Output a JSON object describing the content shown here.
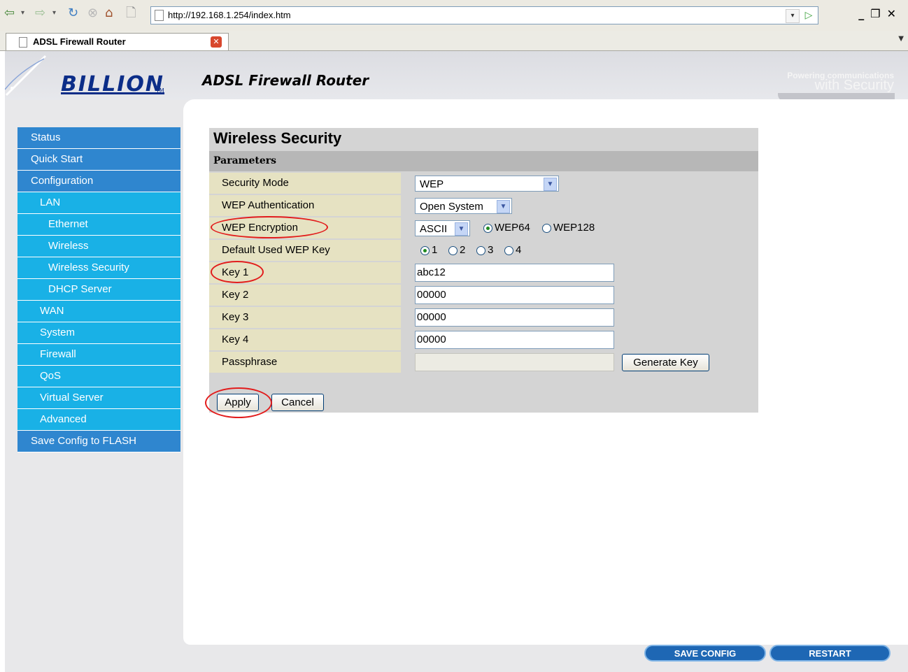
{
  "browser": {
    "url": "http://192.168.1.254/index.htm",
    "tab_title": "ADSL Firewall Router",
    "win_controls": "_ &#9633; ×"
  },
  "header": {
    "logo": "BILLION",
    "logo_tm": "TM",
    "title": "ADSL Firewall Router",
    "tagline_line1": "Powering communications",
    "tagline_line2": "with Security"
  },
  "sidebar": {
    "items": [
      {
        "label": "Status"
      },
      {
        "label": "Quick Start"
      },
      {
        "label": "Configuration"
      },
      {
        "label": "LAN"
      },
      {
        "label": "Ethernet"
      },
      {
        "label": "Wireless"
      },
      {
        "label": "Wireless Security"
      },
      {
        "label": "DHCP Server"
      },
      {
        "label": "WAN"
      },
      {
        "label": "System"
      },
      {
        "label": "Firewall"
      },
      {
        "label": "QoS"
      },
      {
        "label": "Virtual Server"
      },
      {
        "label": "Advanced"
      },
      {
        "label": "Save Config to FLASH"
      }
    ]
  },
  "form": {
    "title": "Wireless Security",
    "section": "Parameters",
    "security_mode_label": "Security Mode",
    "security_mode_value": "WEP",
    "wep_auth_label": "WEP Authentication",
    "wep_auth_value": "Open System",
    "wep_enc_label": "WEP Encryption",
    "wep_enc_value": "ASCII",
    "wep64_label": "WEP64",
    "wep128_label": "WEP128",
    "default_key_label": "Default Used WEP Key",
    "key_options": [
      "1",
      "2",
      "3",
      "4"
    ],
    "key1_label": "Key 1",
    "key1_value": "abc12",
    "key2_label": "Key 2",
    "key2_value": "00000",
    "key3_label": "Key 3",
    "key3_value": "00000",
    "key4_label": "Key 4",
    "key4_value": "00000",
    "passphrase_label": "Passphrase",
    "passphrase_value": "",
    "generate_key_label": "Generate Key",
    "apply_label": "Apply",
    "cancel_label": "Cancel"
  },
  "footer": {
    "save_config_label": "SAVE CONFIG",
    "restart_label": "RESTART"
  }
}
